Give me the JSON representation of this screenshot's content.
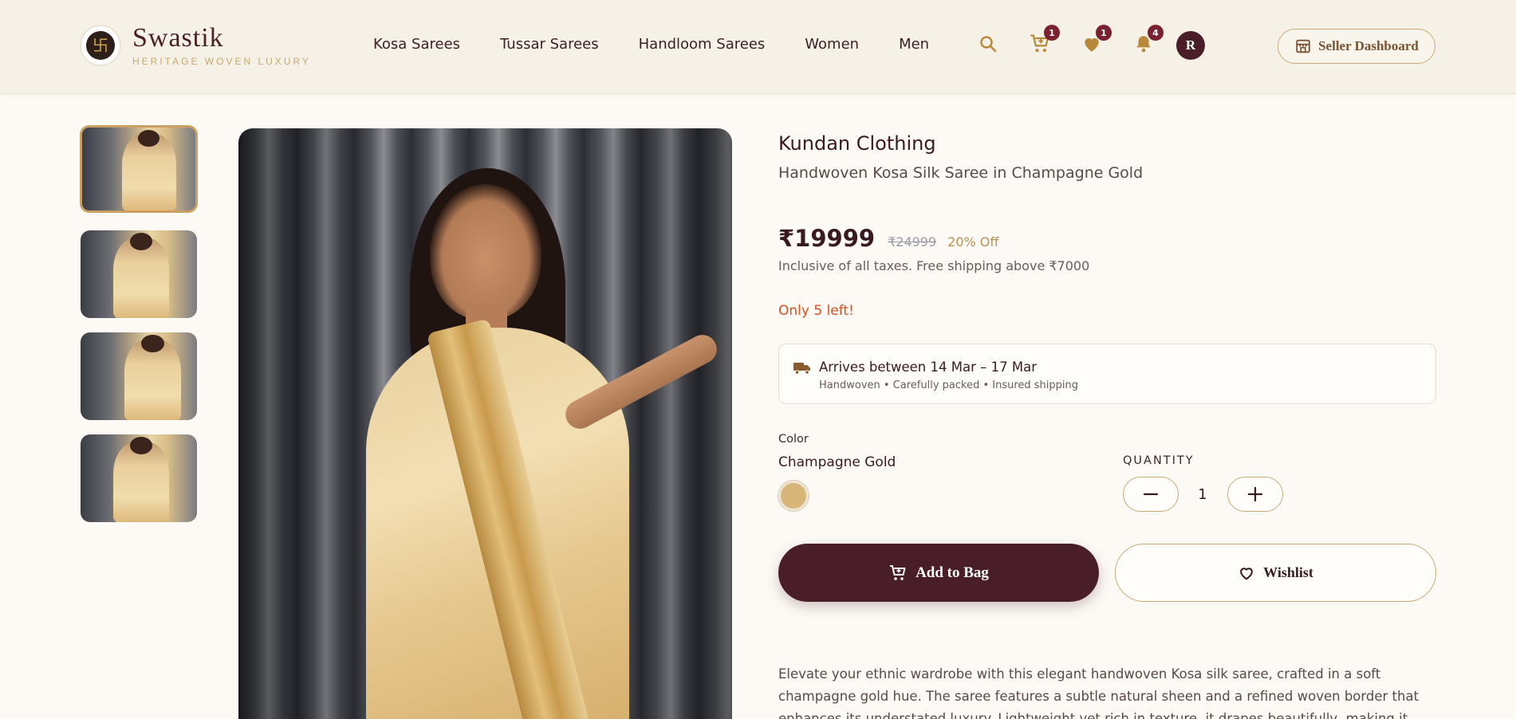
{
  "brand": {
    "name": "Swastik",
    "tagline": "HERITAGE WOVEN LUXURY",
    "symbol": "卐"
  },
  "nav": {
    "items": [
      "Kosa Sarees",
      "Tussar Sarees",
      "Handloom Sarees",
      "Women",
      "Men"
    ]
  },
  "header_icons": {
    "cart_count": "1",
    "wishlist_count": "1",
    "notifications_count": "4",
    "avatar_initial": "R",
    "icons": [
      "search-icon",
      "cart-icon",
      "heart-icon",
      "bell-icon"
    ]
  },
  "seller_button": {
    "label": "Seller Dashboard",
    "icon": "store-icon"
  },
  "gallery": {
    "thumbnail_count": 4,
    "active_index": 0
  },
  "product": {
    "brand": "Kundan Clothing",
    "name": "Handwoven Kosa Silk Saree in Champagne Gold",
    "price": "₹19999",
    "mrp": "₹24999",
    "discount": "20% Off",
    "tax_note": "Inclusive of all taxes. Free shipping above ₹7000",
    "stock_note": "Only 5 left!",
    "delivery_title": "Arrives between 14 Mar – 17 Mar",
    "delivery_sub": "Handwoven • Carefully packed • Insured shipping",
    "color_label": "Color",
    "color_value": "Champagne Gold",
    "quantity_label": "QUANTITY",
    "quantity": "1",
    "add_to_bag": "Add to Bag",
    "wishlist": "Wishlist",
    "description": "Elevate your ethnic wardrobe with this elegant handwoven Kosa silk saree, crafted in a soft champagne gold hue. The saree features a subtle natural sheen and a refined woven border that enhances its understated luxury. Lightweight yet rich in texture, it drapes beautifully, making it ideal for festive"
  },
  "colors": {
    "primary": "#4a1e28",
    "accent": "#c9a979",
    "stock_alert": "#d8501e",
    "swatch": "#d8b679",
    "header_bg": "#f6f1e7"
  }
}
